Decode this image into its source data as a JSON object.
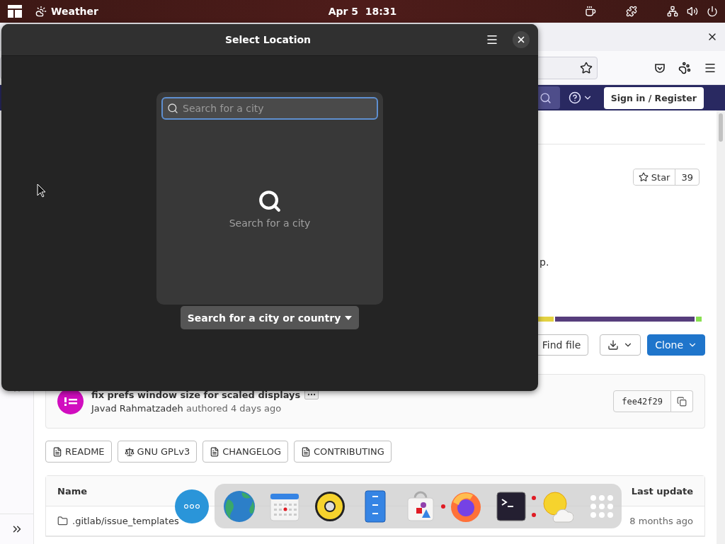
{
  "top_bar": {
    "app_name": "Weather",
    "clock": "Apr 5  18:31"
  },
  "browser": {
    "nav": {
      "sign_in": "Sign in / Register"
    },
    "star": {
      "label": "Star",
      "count": "39"
    },
    "description_tail": "p.",
    "language_bar": [
      {
        "color": "#e3d242"
      },
      {
        "color": "#563d7c"
      },
      {
        "color": "#89e051"
      }
    ],
    "actions": {
      "find_file": "Find file",
      "clone": "Clone"
    },
    "commit": {
      "title": "fix prefs window size for scaled displays",
      "author": "Javad Rahmatzadeh",
      "meta": "authored 4 days ago",
      "hash": "fee42f29"
    },
    "file_links": [
      {
        "kind": "doc",
        "label": "README"
      },
      {
        "kind": "license",
        "label": "GNU GPLv3"
      },
      {
        "kind": "doc",
        "label": "CHANGELOG"
      },
      {
        "kind": "doc",
        "label": "CONTRIBUTING"
      }
    ],
    "table": {
      "columns": [
        "Name",
        "Last update"
      ],
      "rows": [
        {
          "name": ".gitlab/issue_templates",
          "last_update": "8 months ago"
        }
      ]
    }
  },
  "dialog": {
    "title": "Select Location",
    "search": {
      "placeholder": "Search for a city"
    },
    "empty_text": "Search for a city",
    "mode_button": "Search for a city or country"
  },
  "dock": [
    {
      "kind": "globe",
      "running": false,
      "multi": false
    },
    {
      "kind": "calendar",
      "running": false,
      "multi": false
    },
    {
      "kind": "speaker",
      "running": false,
      "multi": false
    },
    {
      "kind": "archive",
      "running": false,
      "multi": false
    },
    {
      "kind": "store",
      "running": false,
      "multi": false
    },
    {
      "kind": "browser",
      "running": true,
      "multi": false
    },
    {
      "kind": "terminal",
      "running": false,
      "multi": false
    },
    {
      "kind": "weather",
      "running": true,
      "multi": true
    },
    {
      "kind": "apps",
      "running": false,
      "multi": false
    }
  ]
}
